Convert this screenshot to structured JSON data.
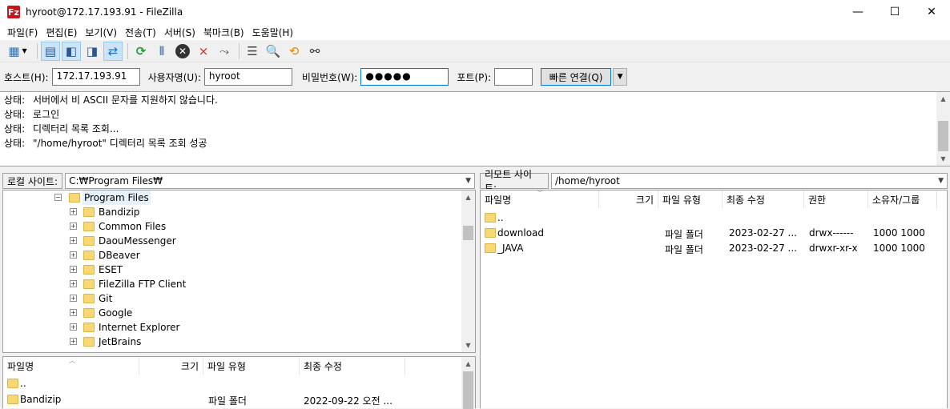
{
  "window": {
    "title": "hyroot@172.17.193.91 - FileZilla",
    "app_icon": "Fz",
    "minimize": "—",
    "maximize": "☐",
    "close": "✕"
  },
  "menu": [
    "파일(F)",
    "편집(E)",
    "보기(V)",
    "전송(T)",
    "서버(S)",
    "북마크(B)",
    "도움말(H)"
  ],
  "quickconnect": {
    "host_label": "호스트(H):",
    "host_value": "172.17.193.91",
    "user_label": "사용자명(U):",
    "user_value": "hyroot",
    "pass_label": "비밀번호(W):",
    "pass_value": "●●●●●",
    "port_label": "포트(P):",
    "port_value": "",
    "connect_label": "빠른 연결(Q)"
  },
  "log": [
    {
      "status": "상태:",
      "text": "서버에서 비 ASCII 문자를 지원하지 않습니다."
    },
    {
      "status": "상태:",
      "text": "로그인"
    },
    {
      "status": "상태:",
      "text": "디렉터리 목록 조회..."
    },
    {
      "status": "상태:",
      "text": "\"/home/hyroot\" 디렉터리 목록 조회 성공"
    }
  ],
  "local": {
    "site_label": "로컬 사이트:",
    "path": "C:₩Program Files₩",
    "tree_root": "Program Files",
    "tree_items": [
      "Bandizip",
      "Common Files",
      "DaouMessenger",
      "DBeaver",
      "ESET",
      "FileZilla FTP Client",
      "Git",
      "Google",
      "Internet Explorer",
      "JetBrains"
    ],
    "columns": {
      "name": "파일명",
      "size": "크기",
      "type": "파일 유형",
      "modified": "최종 수정"
    },
    "files": [
      {
        "name": "..",
        "type": "",
        "modified": ""
      },
      {
        "name": "Bandizip",
        "type": "파일 폴더",
        "modified": "2022-09-22 오전 ..."
      }
    ]
  },
  "remote": {
    "site_label": "리모트 사이트:",
    "path": "/home/hyroot",
    "columns": {
      "name": "파일명",
      "size": "크기",
      "type": "파일 유형",
      "modified": "최종 수정",
      "perms": "권한",
      "owner": "소유자/그룹"
    },
    "files": [
      {
        "name": "..",
        "type": "",
        "modified": "",
        "perms": "",
        "owner": ""
      },
      {
        "name": "download",
        "type": "파일 폴더",
        "modified": "2023-02-27 ...",
        "perms": "drwx------",
        "owner": "1000 1000"
      },
      {
        "name": "_JAVA",
        "type": "파일 폴더",
        "modified": "2023-02-27 ...",
        "perms": "drwxr-xr-x",
        "owner": "1000 1000"
      }
    ]
  }
}
